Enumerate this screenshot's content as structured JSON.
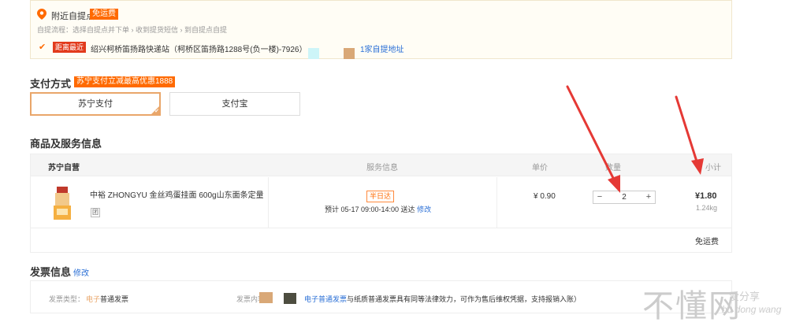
{
  "pickup": {
    "title": "附近自提点",
    "free_tag": "免运费",
    "steps": "自提流程：选择自提点并下单 › 收到提货短信 › 到自提点自提",
    "nearest_tag": "距离最近",
    "address": "绍兴柯桥笛扬路快递站（柯桥区笛扬路1288号(负一楼)-7926）",
    "change_link": "1家自提地址"
  },
  "payment": {
    "title": "支付方式",
    "promo": "苏宁支付立减最高优惠1888",
    "options": [
      {
        "label": "苏宁支付",
        "selected": true
      },
      {
        "label": "支付宝",
        "selected": false
      }
    ]
  },
  "goods": {
    "title": "商品及服务信息",
    "header": {
      "store": "苏宁自营",
      "service": "服务信息",
      "price": "单价",
      "qty": "数量",
      "subtotal": "小计"
    },
    "item": {
      "name": "中裕 ZHONGYU 金丝鸡蛋挂面 600g山东面条定量包...",
      "badge": "团",
      "service_tag": "半日达",
      "delivery": "预计 05-17 09:00-14:00 送达",
      "delivery_edit": "修改",
      "price": "¥ 0.90",
      "qty": "2",
      "minus": "−",
      "plus": "+",
      "subtotal": "¥1.80",
      "weight": "1.24kg"
    },
    "freight": "免运费"
  },
  "invoice": {
    "title": "发票信息",
    "edit": "修改",
    "type_label": "发票类型：",
    "type_value_hl": "电子",
    "type_value_rest": "普通发票",
    "content_label": "发票内容",
    "note_hl": "电子普通发票",
    "note_rest": "与纸质普通发票具有同等法律效力，可作为售后维权凭据，支持报销入账）"
  },
  "watermark": {
    "main": "不懂网",
    "sub": "爱分享",
    "pinyin": "bu dong wang"
  },
  "colors": {
    "accent": "#ff6a00",
    "link": "#2a6fd6",
    "selected_border": "#e9a66a",
    "arrow": "#e53935"
  }
}
